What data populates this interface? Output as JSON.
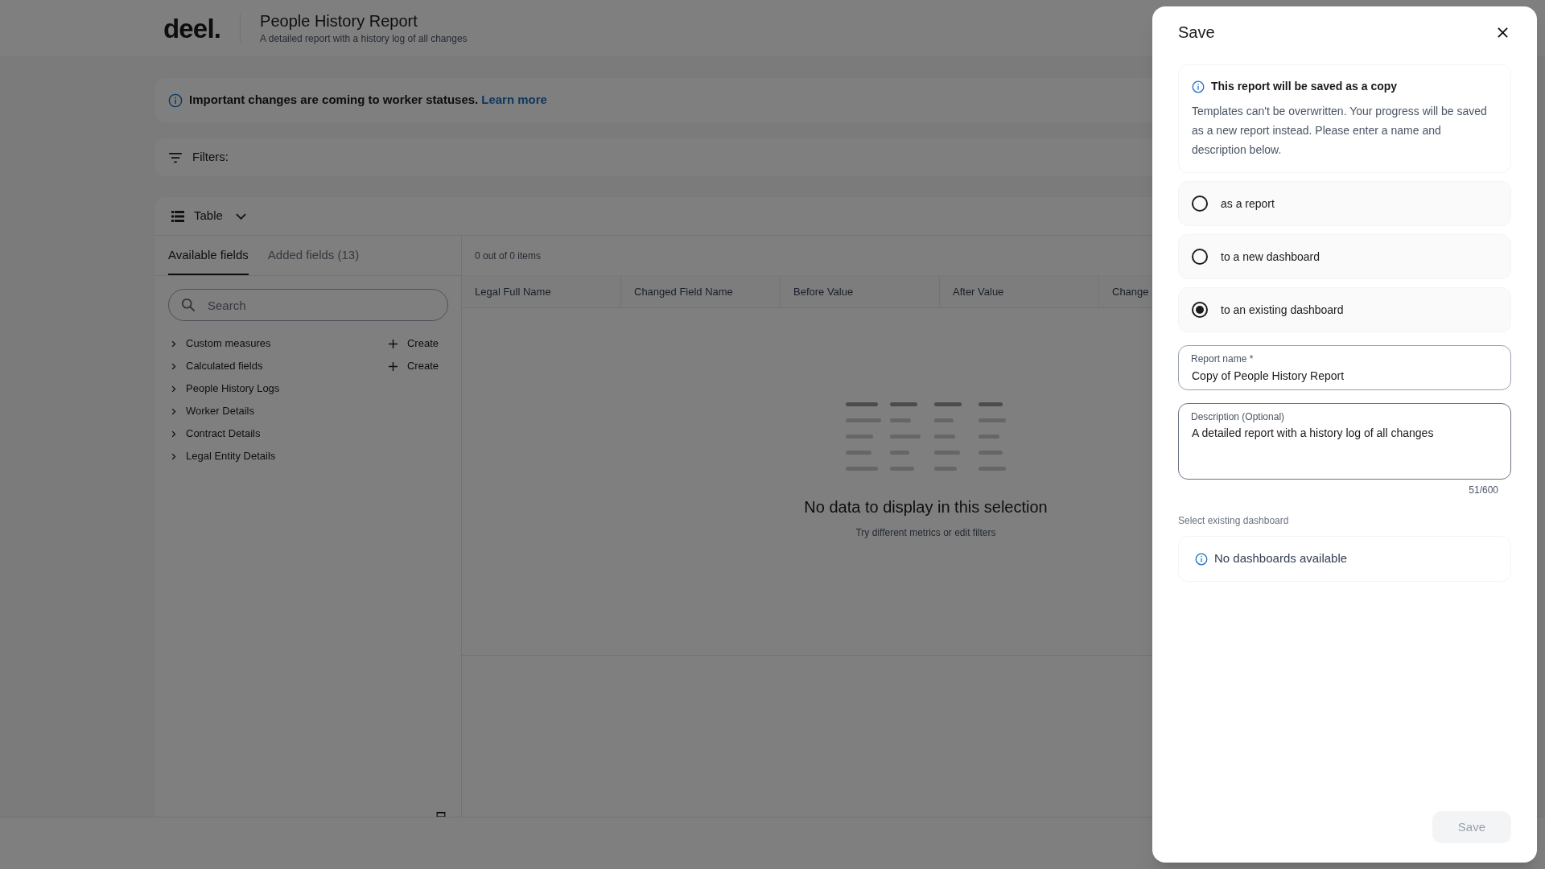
{
  "header": {
    "logo": "deel.",
    "title": "People History Report",
    "subtitle": "A detailed report with a history log of all changes"
  },
  "banner": {
    "text": "Important changes are coming to worker statuses.",
    "link": "Learn more"
  },
  "filters": {
    "label": "Filters:"
  },
  "view_selector": {
    "label": "Table"
  },
  "fields_panel": {
    "tabs": [
      {
        "label": "Available fields",
        "selected": true
      },
      {
        "label": "Added fields (13)",
        "selected": false
      }
    ],
    "search": {
      "placeholder": "Search"
    },
    "groups": [
      {
        "label": "Custom measures",
        "action": "Create"
      },
      {
        "label": "Calculated fields",
        "action": "Create"
      },
      {
        "label": "People History Logs"
      },
      {
        "label": "Worker Details"
      },
      {
        "label": "Contract Details"
      },
      {
        "label": "Legal Entity Details"
      }
    ]
  },
  "table": {
    "summary": "0 out of 0 items",
    "columns": [
      "Legal Full Name",
      "Changed Field Name",
      "Before Value",
      "After Value",
      "Change"
    ],
    "empty_state": {
      "title": "No data to display in this selection",
      "subtitle": "Try different metrics or edit filters"
    }
  },
  "dialog": {
    "title": "Save",
    "notice": {
      "title": "This report will be saved as a copy",
      "body": "Templates can't be overwritten. Your progress will be saved as a new report instead. Please enter a name and description below."
    },
    "options": [
      {
        "label": "as a report",
        "selected": false
      },
      {
        "label": "to a new dashboard",
        "selected": false
      },
      {
        "label": "to an existing dashboard",
        "selected": true
      }
    ],
    "report_name": {
      "label": "Report name *",
      "value": "Copy of People History Report"
    },
    "description": {
      "label": "Description (Optional)",
      "value": "A detailed report with a history log of all changes",
      "counter": "51/600"
    },
    "dashboard": {
      "label": "Select existing dashboard",
      "message": "No dashboards available"
    },
    "save_button": {
      "label": "Save",
      "disabled": true
    }
  }
}
